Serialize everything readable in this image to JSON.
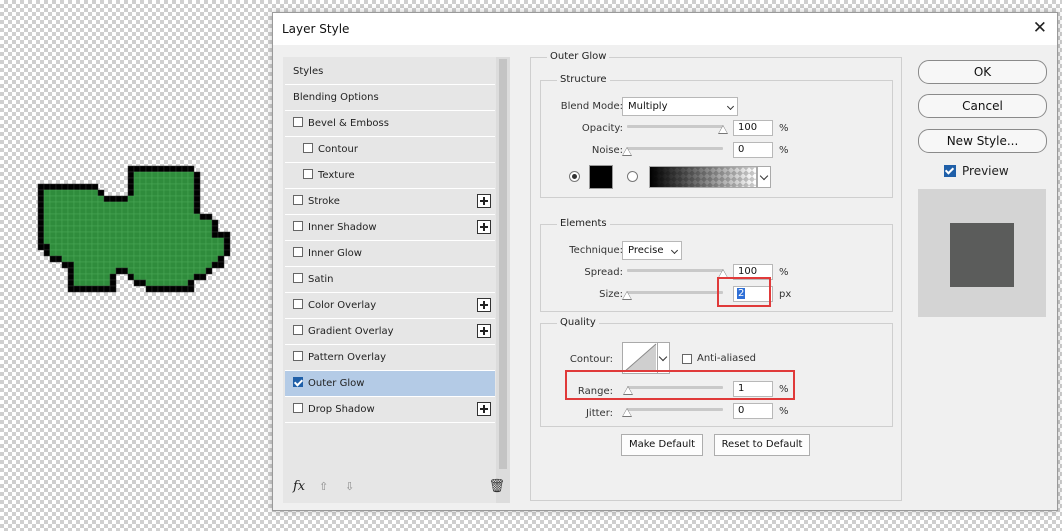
{
  "dialog": {
    "title": "Layer Style",
    "close_glyph": "✕"
  },
  "styles_list": [
    {
      "label": "Styles",
      "checkbox": false,
      "plus": false,
      "indent": false,
      "selected": false,
      "checked": false
    },
    {
      "label": "Blending Options",
      "checkbox": false,
      "plus": false,
      "indent": false,
      "selected": false,
      "checked": false
    },
    {
      "label": "Bevel & Emboss",
      "checkbox": true,
      "plus": false,
      "indent": false,
      "selected": false,
      "checked": false
    },
    {
      "label": "Contour",
      "checkbox": true,
      "plus": false,
      "indent": true,
      "selected": false,
      "checked": false
    },
    {
      "label": "Texture",
      "checkbox": true,
      "plus": false,
      "indent": true,
      "selected": false,
      "checked": false
    },
    {
      "label": "Stroke",
      "checkbox": true,
      "plus": true,
      "indent": false,
      "selected": false,
      "checked": false
    },
    {
      "label": "Inner Shadow",
      "checkbox": true,
      "plus": true,
      "indent": false,
      "selected": false,
      "checked": false
    },
    {
      "label": "Inner Glow",
      "checkbox": true,
      "plus": false,
      "indent": false,
      "selected": false,
      "checked": false
    },
    {
      "label": "Satin",
      "checkbox": true,
      "plus": false,
      "indent": false,
      "selected": false,
      "checked": false
    },
    {
      "label": "Color Overlay",
      "checkbox": true,
      "plus": true,
      "indent": false,
      "selected": false,
      "checked": false
    },
    {
      "label": "Gradient Overlay",
      "checkbox": true,
      "plus": true,
      "indent": false,
      "selected": false,
      "checked": false
    },
    {
      "label": "Pattern Overlay",
      "checkbox": true,
      "plus": false,
      "indent": false,
      "selected": false,
      "checked": false
    },
    {
      "label": "Outer Glow",
      "checkbox": true,
      "plus": false,
      "indent": false,
      "selected": true,
      "checked": true
    },
    {
      "label": "Drop Shadow",
      "checkbox": true,
      "plus": true,
      "indent": false,
      "selected": false,
      "checked": false
    }
  ],
  "bottom_toolbar": {
    "fx_label": "fx",
    "up_glyph": "⇧",
    "down_glyph": "⇩",
    "trash_glyph": "🗑"
  },
  "outer_glow": {
    "title": "Outer Glow",
    "structure": {
      "title": "Structure",
      "blend_mode_label": "Blend Mode:",
      "blend_mode_value": "Multiply",
      "opacity_label": "Opacity:",
      "opacity_value": "100",
      "opacity_percent": 100,
      "opacity_unit": "%",
      "noise_label": "Noise:",
      "noise_value": "0",
      "noise_percent": 0,
      "noise_unit": "%",
      "glow_color": "#000000",
      "color_mode": "solid"
    },
    "elements": {
      "title": "Elements",
      "technique_label": "Technique:",
      "technique_value": "Precise",
      "spread_label": "Spread:",
      "spread_value": "100",
      "spread_percent": 100,
      "spread_unit": "%",
      "size_label": "Size:",
      "size_value": "2",
      "size_unit": "px",
      "size_slider_fraction": 0.0
    },
    "quality": {
      "title": "Quality",
      "contour_label": "Contour:",
      "anti_aliased_label": "Anti-aliased",
      "anti_aliased_checked": false,
      "range_label": "Range:",
      "range_value": "1",
      "range_percent": 1,
      "range_unit": "%",
      "jitter_label": "Jitter:",
      "jitter_value": "0",
      "jitter_percent": 0,
      "jitter_unit": "%"
    },
    "make_default_label": "Make Default",
    "reset_default_label": "Reset to Default"
  },
  "actions": {
    "ok_label": "OK",
    "cancel_label": "Cancel",
    "new_style_label": "New Style...",
    "preview_label": "Preview",
    "preview_checked": true
  },
  "colors": {
    "selected_row": "#b4cbe6",
    "highlight": "#e03a3a",
    "art_fill": "#2f8c3c",
    "preview_square": "#5b5c5b"
  }
}
